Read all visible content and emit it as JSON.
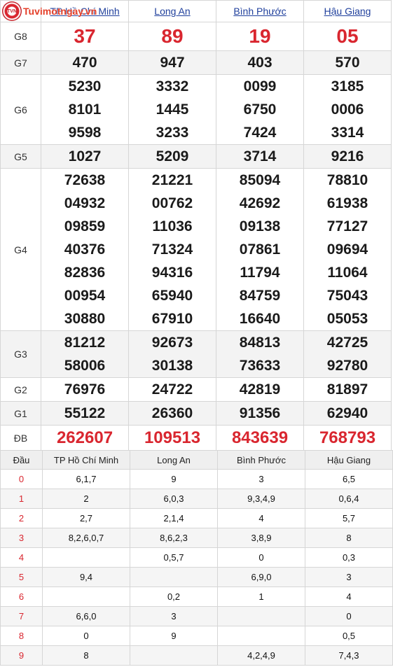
{
  "brand": {
    "name": "Tuvimotngay.vn",
    "logo_text": "TVN"
  },
  "provinces": [
    "TP Hồ Chí Minh",
    "Long An",
    "Bình Phước",
    "Hậu Giang"
  ],
  "prizes": [
    {
      "label": "G8",
      "values": [
        [
          "37"
        ],
        [
          "89"
        ],
        [
          "19"
        ],
        [
          "05"
        ]
      ]
    },
    {
      "label": "G7",
      "values": [
        [
          "470"
        ],
        [
          "947"
        ],
        [
          "403"
        ],
        [
          "570"
        ]
      ]
    },
    {
      "label": "G6",
      "values": [
        [
          "5230",
          "8101",
          "9598"
        ],
        [
          "3332",
          "1445",
          "3233"
        ],
        [
          "0099",
          "6750",
          "7424"
        ],
        [
          "3185",
          "0006",
          "3314"
        ]
      ]
    },
    {
      "label": "G5",
      "values": [
        [
          "1027"
        ],
        [
          "5209"
        ],
        [
          "3714"
        ],
        [
          "9216"
        ]
      ]
    },
    {
      "label": "G4",
      "values": [
        [
          "72638",
          "04932",
          "09859",
          "40376",
          "82836",
          "00954",
          "30880"
        ],
        [
          "21221",
          "00762",
          "11036",
          "71324",
          "94316",
          "65940",
          "67910"
        ],
        [
          "85094",
          "42692",
          "09138",
          "07861",
          "11794",
          "84759",
          "16640"
        ],
        [
          "78810",
          "61938",
          "77127",
          "09694",
          "11064",
          "75043",
          "05053"
        ]
      ]
    },
    {
      "label": "G3",
      "values": [
        [
          "81212",
          "58006"
        ],
        [
          "92673",
          "30138"
        ],
        [
          "84813",
          "73633"
        ],
        [
          "42725",
          "92780"
        ]
      ]
    },
    {
      "label": "G2",
      "values": [
        [
          "76976"
        ],
        [
          "24722"
        ],
        [
          "42819"
        ],
        [
          "81897"
        ]
      ]
    },
    {
      "label": "G1",
      "values": [
        [
          "55122"
        ],
        [
          "26360"
        ],
        [
          "91356"
        ],
        [
          "62940"
        ]
      ]
    },
    {
      "label": "ĐB",
      "values": [
        [
          "262607"
        ],
        [
          "109513"
        ],
        [
          "843639"
        ],
        [
          "768793"
        ]
      ]
    }
  ],
  "loto": {
    "header": "Đầu",
    "rows": [
      {
        "dau": "0",
        "cells": [
          "6,1,7",
          "9",
          "3",
          "6,5"
        ]
      },
      {
        "dau": "1",
        "cells": [
          "2",
          "6,0,3",
          "9,3,4,9",
          "0,6,4"
        ]
      },
      {
        "dau": "2",
        "cells": [
          "2,7",
          "2,1,4",
          "4",
          "5,7"
        ]
      },
      {
        "dau": "3",
        "cells": [
          "8,2,6,0,7",
          "8,6,2,3",
          "3,8,9",
          "8"
        ]
      },
      {
        "dau": "4",
        "cells": [
          "",
          "0,5,7",
          "0",
          "0,3"
        ]
      },
      {
        "dau": "5",
        "cells": [
          "9,4",
          "",
          "6,9,0",
          "3"
        ]
      },
      {
        "dau": "6",
        "cells": [
          "",
          "0,2",
          "1",
          "4"
        ]
      },
      {
        "dau": "7",
        "cells": [
          "6,6,0",
          "3",
          "",
          "0"
        ]
      },
      {
        "dau": "8",
        "cells": [
          "0",
          "9",
          "",
          "0,5"
        ]
      },
      {
        "dau": "9",
        "cells": [
          "8",
          "",
          "4,2,4,9",
          "7,4,3"
        ]
      }
    ]
  }
}
